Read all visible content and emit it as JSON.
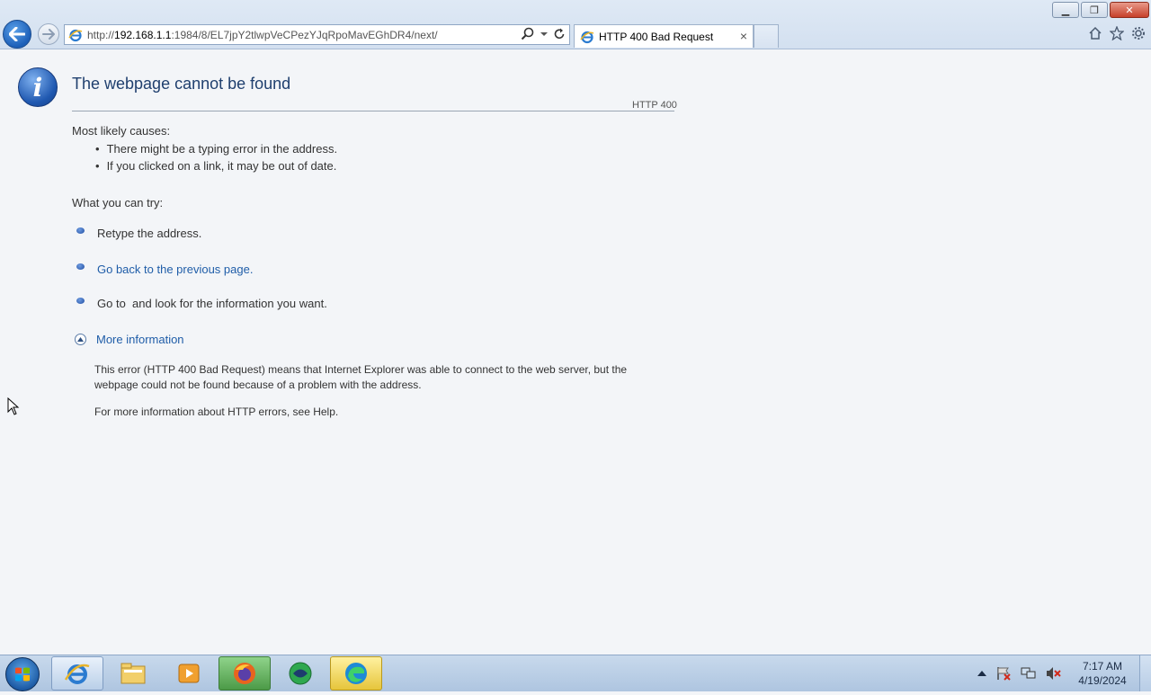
{
  "browser": {
    "url_prefix": "http://",
    "url_host": "192.168.1.1",
    "url_rest": ":1984/8/EL7jpY2tlwpVeCPezYJqRpoMavEGhDR4/next/",
    "tab_title": "HTTP 400 Bad Request",
    "tab_close": "×"
  },
  "window_controls": {
    "minimize": "▁",
    "restore": "❐",
    "close": "✕"
  },
  "page": {
    "title": "The webpage cannot be found",
    "http_code": "HTTP 400",
    "causes_heading": "Most likely causes:",
    "causes": [
      "There might be a typing error in the address.",
      "If you clicked on a link, it may be out of date."
    ],
    "try_heading": "What you can try:",
    "try_items": [
      "Retype the address.",
      "Go back to the previous page.",
      "Go to  and look for the information you want."
    ],
    "more_info": "More information",
    "detail_1": "This error (HTTP 400 Bad Request) means that Internet Explorer was able to connect to the web server, but the webpage could not be found because of a problem with the address.",
    "detail_2": "For more information about HTTP errors, see Help."
  },
  "taskbar": {
    "apps": [
      "internet-explorer-icon",
      "file-explorer-icon",
      "media-player-icon",
      "firefox-icon",
      "app-icon",
      "edge-icon"
    ],
    "time": "7:17 AM",
    "date": "4/19/2024"
  },
  "colors": {
    "link": "#1f5da8",
    "title": "#1f3f6e",
    "text": "#333333"
  }
}
